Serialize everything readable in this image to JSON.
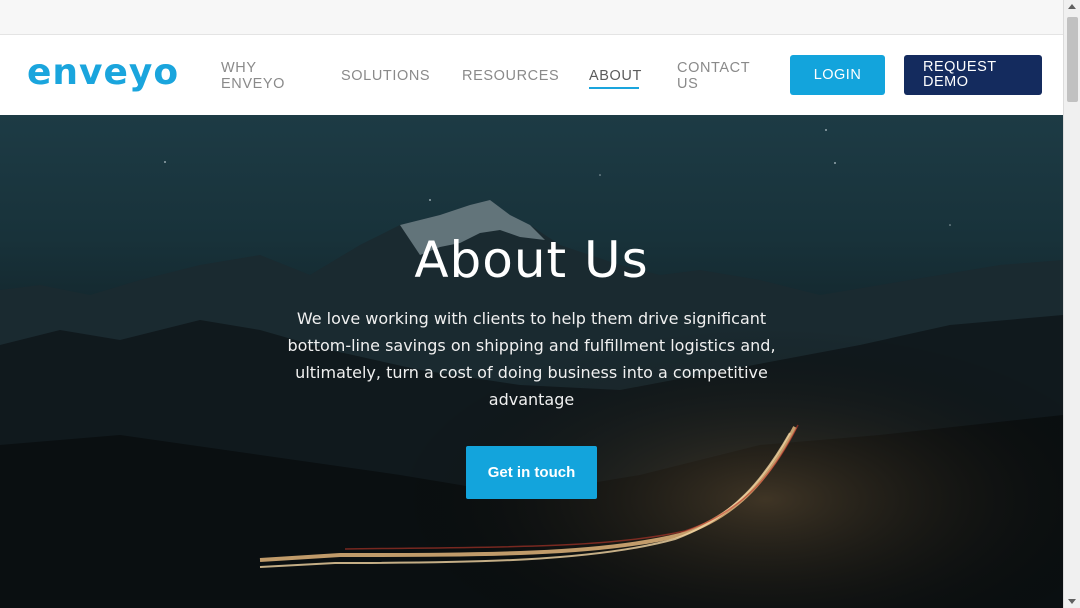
{
  "header": {
    "logo_text": "enveyo",
    "nav": {
      "why": "WHY ENVEYO",
      "solutions": "SOLUTIONS",
      "resources": "RESOURCES",
      "about": "ABOUT",
      "contact": "CONTACT US"
    },
    "login_label": "LOGIN",
    "demo_label": "REQUEST DEMO"
  },
  "hero": {
    "title": "About Us",
    "text": "We love working with clients to help them drive significant bottom-line savings on shipping and fulfillment logistics and, ultimately, turn a cost of doing business into a competitive advantage",
    "cta_label": "Get in touch"
  },
  "colors": {
    "accent": "#13a4dc",
    "navy": "#142b5e"
  }
}
